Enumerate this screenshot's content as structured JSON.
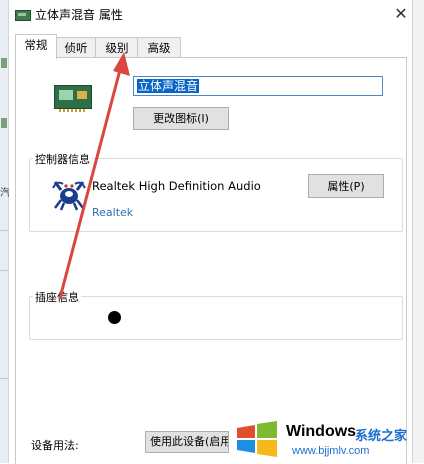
{
  "window": {
    "title": "立体声混音 属性",
    "close_glyph": "✕"
  },
  "tabs": [
    {
      "label": "常规",
      "active": true
    },
    {
      "label": "侦听",
      "active": false
    },
    {
      "label": "级别",
      "active": false
    },
    {
      "label": "高级",
      "active": false
    }
  ],
  "device": {
    "name_value": "立体声混音",
    "change_icon_button": "更改图标(I)"
  },
  "controller": {
    "group_label": "控制器信息",
    "driver_name": "Realtek High Definition Audio",
    "vendor": "Realtek",
    "properties_button": "属性(P)"
  },
  "jack": {
    "group_label": "插座信息"
  },
  "usage": {
    "label": "设备用法:",
    "selected_value": "使用此设备(启用"
  },
  "watermark": {
    "brand": "Windows",
    "suffix": "系统之家",
    "url": "www.bjjmlv.com"
  },
  "colors": {
    "accent": "#0a64c8",
    "annotation_arrow": "#d9473f",
    "vendor_link": "#2e6fb5"
  },
  "icons": {
    "title_icon": "sound-card-icon",
    "device_icon": "sound-card-icon",
    "controller_icon": "realtek-crab-icon",
    "close_icon": "close-icon",
    "watermark_logo": "windows-logo-icon"
  }
}
